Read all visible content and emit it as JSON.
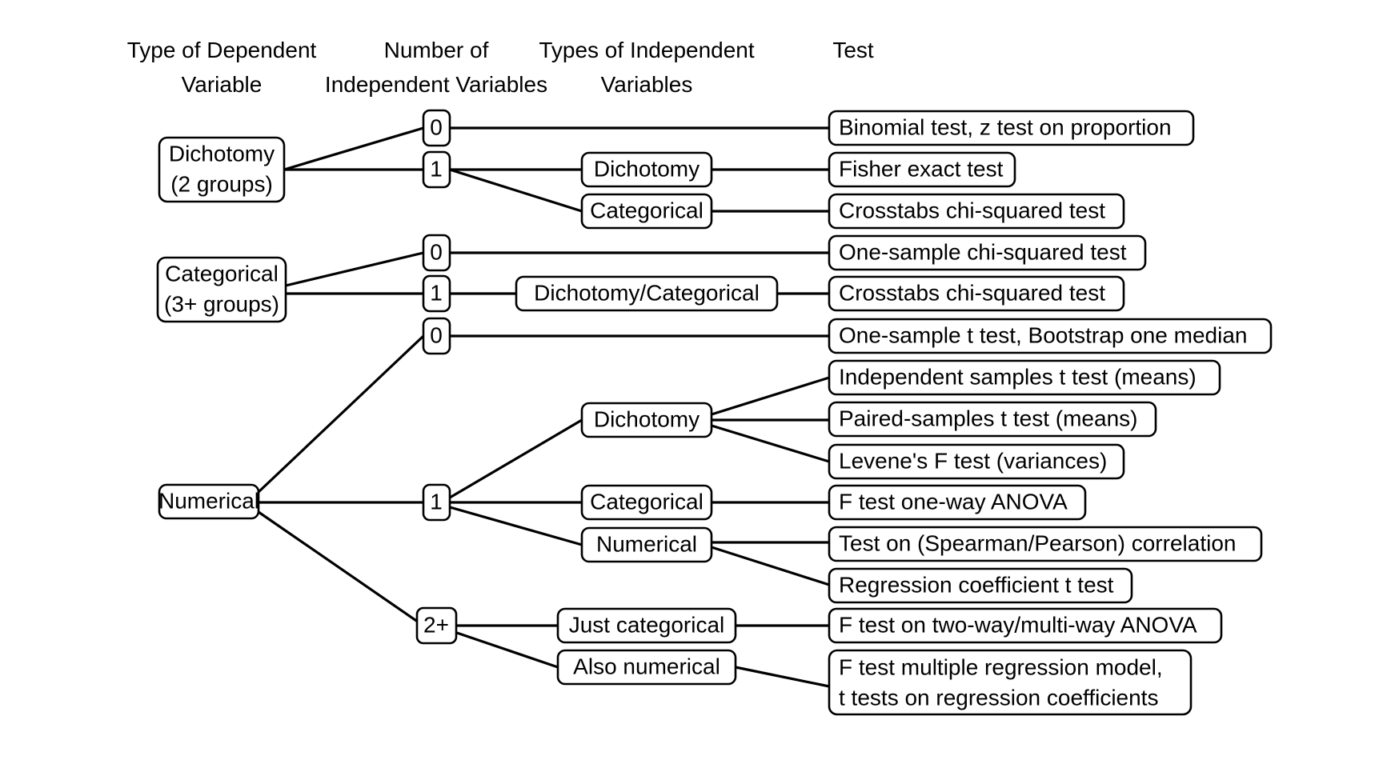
{
  "headers": [
    {
      "line1": "Type of Dependent",
      "line2": "Variable"
    },
    {
      "line1": "Number of",
      "line2": "Independent Variables"
    },
    {
      "line1": "Types of Independent",
      "line2": "Variables"
    },
    {
      "line1": "Test",
      "line2": ""
    }
  ],
  "nodes": {
    "dv_dichotomy_l1": "Dichotomy",
    "dv_dichotomy_l2": "(2 groups)",
    "dv_categorical_l1": "Categorical",
    "dv_categorical_l2": "(3+ groups)",
    "dv_numerical": "Numerical",
    "n_dich_0": "0",
    "n_dich_1": "1",
    "n_cat_0": "0",
    "n_cat_1": "1",
    "n_num_0": "0",
    "n_num_1": "1",
    "n_num_2plus": "2+",
    "iv_dich_dichotomy": "Dichotomy",
    "iv_dich_categorical": "Categorical",
    "iv_cat_dichcat": "Dichotomy/Categorical",
    "iv_num_dichotomy": "Dichotomy",
    "iv_num_categorical": "Categorical",
    "iv_num_numerical": "Numerical",
    "iv_just_categorical": "Just categorical",
    "iv_also_numerical": "Also numerical"
  },
  "tests": {
    "binomial": "Binomial test, z test on proportion",
    "fisher": "Fisher exact test",
    "crosstabs_1": "Crosstabs chi-squared test",
    "one_sample_chi": "One-sample chi-squared test",
    "crosstabs_2": "Crosstabs chi-squared test",
    "one_sample_t": "One-sample t test, Bootstrap one median",
    "independent_t": "Independent samples t test (means)",
    "paired_t": "Paired-samples t test (means)",
    "levene_f": "Levene's F test (variances)",
    "anova_oneway": "F test one-way ANOVA",
    "correlation": "Test on (Spearman/Pearson) correlation",
    "regression_coef": "Regression coefficient t test",
    "anova_multiway": "F test on two-way/multi-way ANOVA",
    "multiple_regression_l1": "F test multiple regression model,",
    "multiple_regression_l2": " t tests on regression coefficients"
  },
  "colors": {
    "background": "#ffffff",
    "stroke": "#000000",
    "text": "#000000"
  }
}
